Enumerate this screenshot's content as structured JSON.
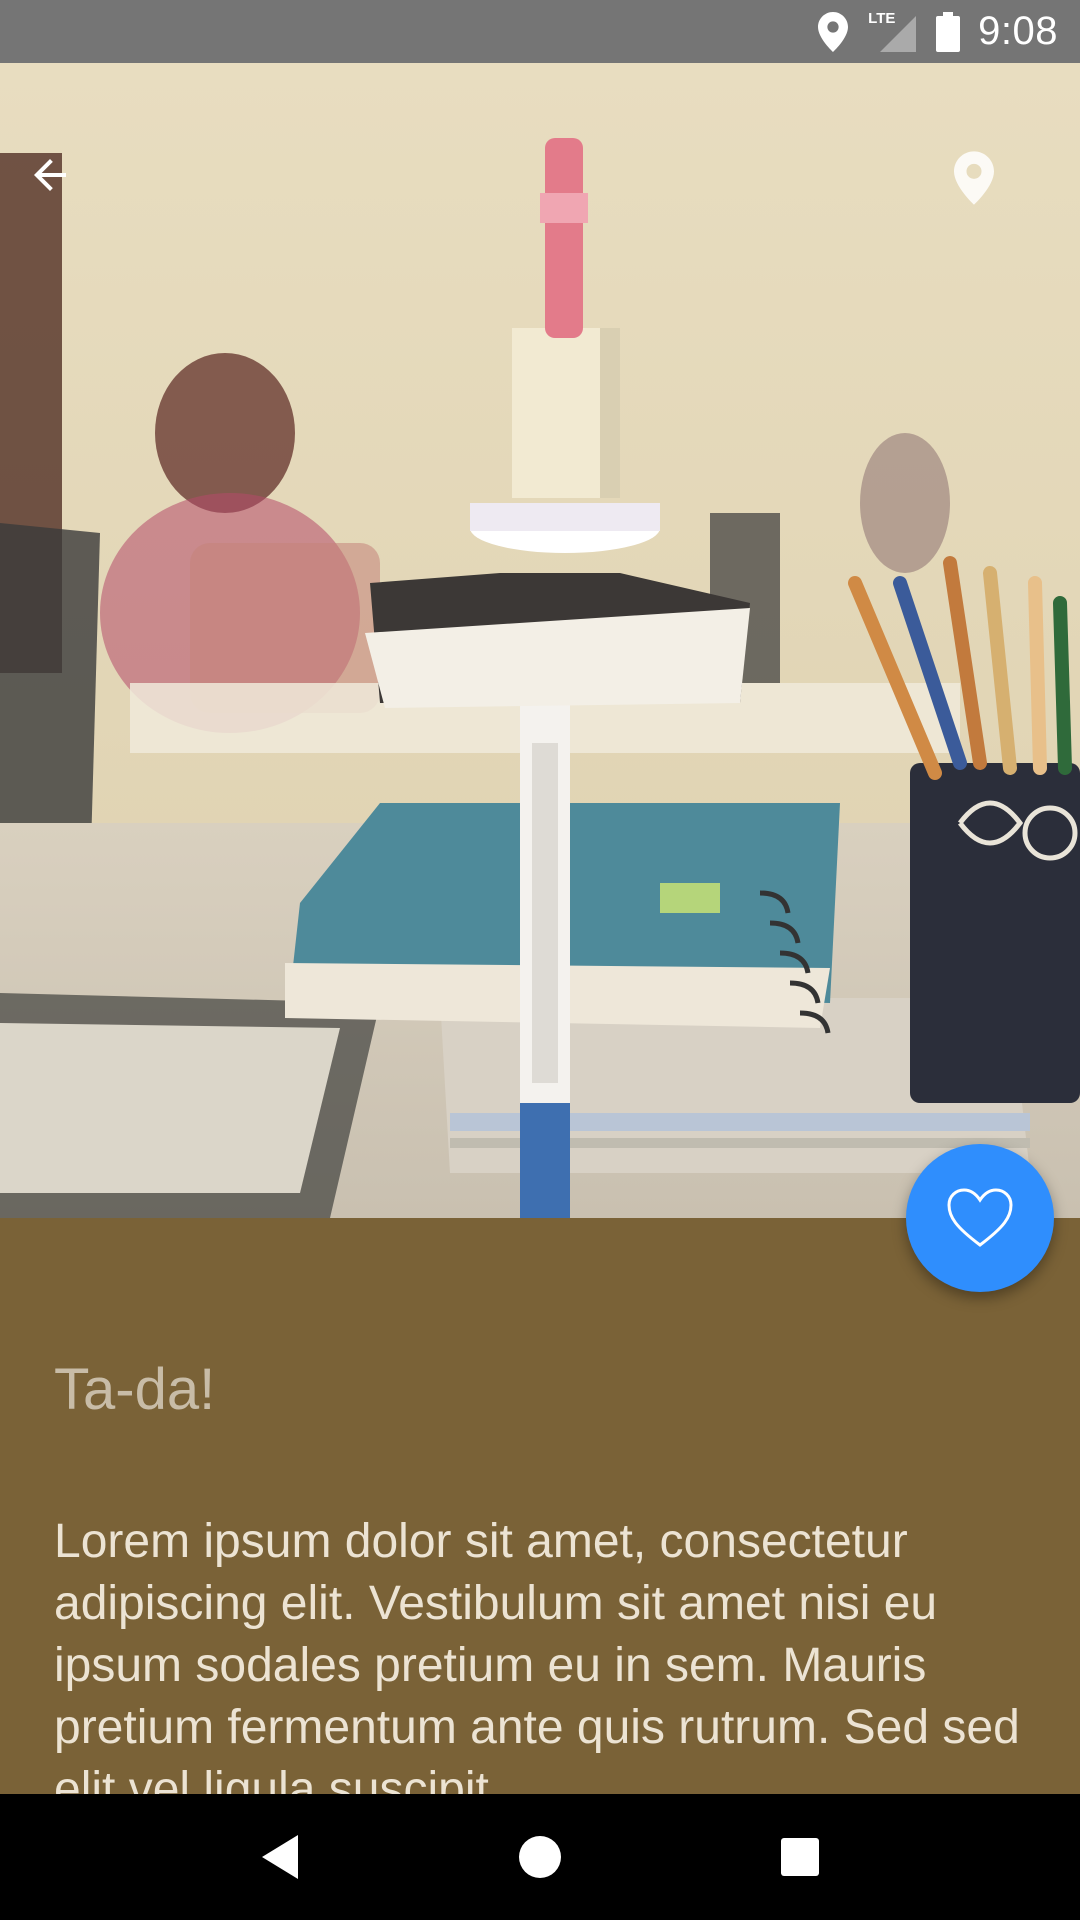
{
  "status_bar": {
    "time": "9:08",
    "network": "LTE",
    "icons": [
      "location-icon",
      "lte-signal-icon",
      "battery-icon"
    ]
  },
  "toolbar": {
    "back_icon": "arrow-back-icon",
    "location_icon": "location-pin-icon"
  },
  "hero": {
    "description_icon": "photo-image"
  },
  "fab": {
    "icon": "heart-outline-icon",
    "color": "#2f8efd"
  },
  "content": {
    "title": "Ta-da!",
    "body": "Lorem ipsum dolor sit amet, consectetur adipiscing elit. Vestibulum sit amet nisi eu ipsum sodales pretium eu in sem. Mauris pretium fermentum ante quis rutrum. Sed sed elit vel ligula suscipit",
    "background_color": "#7a6237"
  },
  "nav_bar": {
    "icons": [
      "back-triangle-icon",
      "home-circle-icon",
      "recents-square-icon"
    ]
  }
}
